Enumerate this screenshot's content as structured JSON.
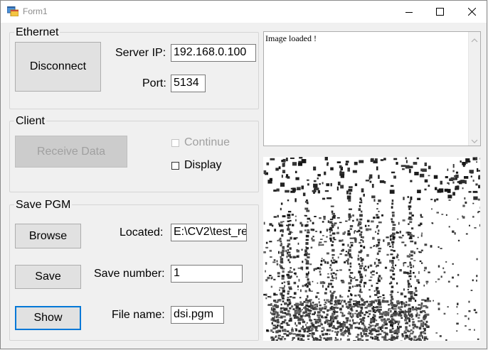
{
  "window": {
    "title": "Form1",
    "icons": {
      "app": "windows-forms-app-icon",
      "minimize": "minimize-icon",
      "maximize": "maximize-icon",
      "close": "close-icon"
    }
  },
  "ethernet": {
    "group_title": "Ethernet",
    "disconnect_label": "Disconnect",
    "server_ip_label": "Server IP:",
    "server_ip_value": "192.168.0.100",
    "port_label": "Port:",
    "port_value": "5134"
  },
  "client": {
    "group_title": "Client",
    "receive_label": "Receive Data",
    "continue_label": "Continue",
    "continue_checked": false,
    "continue_enabled": false,
    "display_label": "Display",
    "display_checked": false
  },
  "save_pgm": {
    "group_title": "Save PGM",
    "browse_label": "Browse",
    "located_label": "Located:",
    "located_value": "E:\\CV2\\test_re",
    "save_label": "Save",
    "save_number_label": "Save number:",
    "save_number_value": "1",
    "show_label": "Show",
    "file_name_label": "File name:",
    "file_name_value": "dsi.pgm"
  },
  "log": {
    "text": "Image loaded !"
  },
  "colors": {
    "accent_focus": "#0078d7",
    "window_bg": "#f0f0f0",
    "image_ink": "#1a1a1a"
  }
}
